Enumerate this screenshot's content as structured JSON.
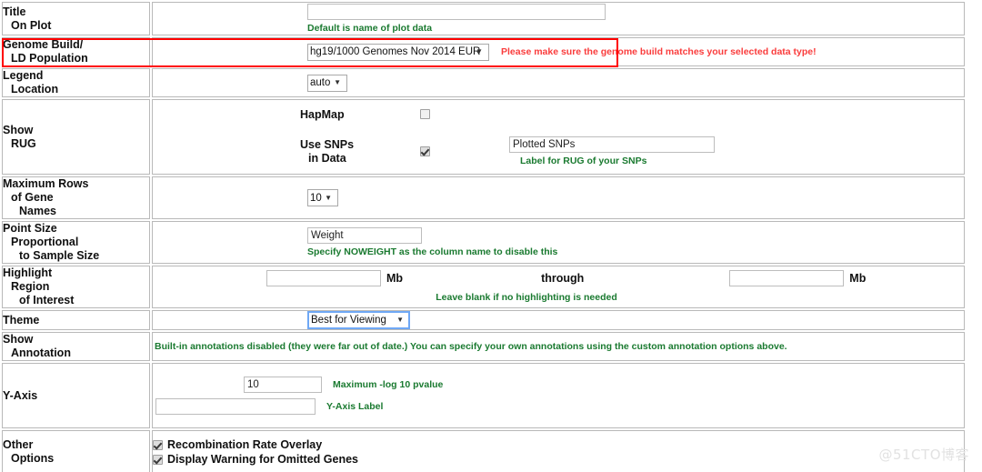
{
  "rows": {
    "title": {
      "label_lines": [
        "Title",
        "On Plot"
      ],
      "input_value": "",
      "hint": "Default is name of plot data"
    },
    "genome_build": {
      "label_lines": [
        "Genome Build/",
        "LD Population"
      ],
      "selected": "hg19/1000 Genomes Nov 2014 EUR",
      "options": [
        "hg19/1000 Genomes Nov 2014 EUR"
      ],
      "warning": "Please make sure the genome build matches your selected data type!",
      "highlight_color": "#ff0000"
    },
    "legend": {
      "label_lines": [
        "Legend",
        "Location"
      ],
      "selected": "auto",
      "options": [
        "auto"
      ]
    },
    "show_rug": {
      "label_lines": [
        "Show",
        "RUG"
      ],
      "hapmap_label": "HapMap",
      "hapmap_checked": false,
      "usesnps_label_lines": [
        "Use SNPs",
        "in Data"
      ],
      "usesnps_checked": true,
      "snp_label_value": "Plotted SNPs",
      "snp_label_hint": "Label for RUG of your SNPs"
    },
    "max_rows": {
      "label_lines": [
        "Maximum Rows",
        "of Gene",
        "Names"
      ],
      "selected": "10",
      "options": [
        "10"
      ]
    },
    "point_size": {
      "label_lines": [
        "Point Size",
        "Proportional",
        "to Sample Size"
      ],
      "input_value": "Weight",
      "hint": "Specify NOWEIGHT as the column name to disable this"
    },
    "highlight": {
      "label_lines": [
        "Highlight",
        "Region",
        "of Interest"
      ],
      "start_value": "",
      "unit_start": "Mb",
      "through_label": "through",
      "end_value": "",
      "unit_end": "Mb",
      "hint": "Leave blank if no highlighting is needed"
    },
    "theme": {
      "label_lines": [
        "Theme"
      ],
      "selected": "Best for Viewing",
      "options": [
        "Best for Viewing"
      ],
      "focused": true
    },
    "show_annotation": {
      "label_lines": [
        "Show",
        "Annotation"
      ],
      "hint": "Built-in annotations disabled (they were far out of date.) You can specify your own annotations using the custom annotation options above."
    },
    "y_axis": {
      "label_lines": [
        "Y-Axis"
      ],
      "max_value": "10",
      "max_hint": "Maximum -log 10 pvalue",
      "label_value": "",
      "label_hint": "Y-Axis Label"
    },
    "other_options": {
      "label_lines": [
        "Other",
        "Options"
      ],
      "items": [
        {
          "label": "Recombination Rate Overlay",
          "checked": true
        },
        {
          "label": "Display Warning for Omitted Genes",
          "checked": true
        }
      ]
    }
  },
  "watermark": "@51CTO博客"
}
